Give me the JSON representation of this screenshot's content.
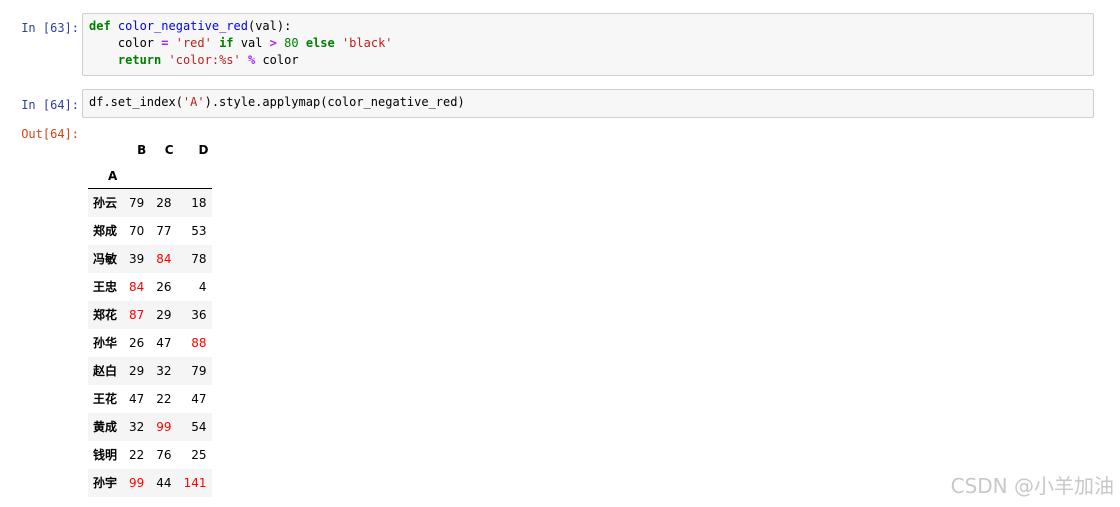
{
  "cells": [
    {
      "prompt": "In  [63]:",
      "code": {
        "l1_def": "def",
        "l1_name": "color_negative_red",
        "l1_rest": "(val):",
        "l2_a": "    color ",
        "l2_eq": "=",
        "l2_b": " ",
        "l2_red": "'red'",
        "l2_c": " ",
        "l2_if": "if",
        "l2_d": " val ",
        "l2_gt": ">",
        "l2_e": " ",
        "l2_num": "80",
        "l2_f": " ",
        "l2_else": "else",
        "l2_g": " ",
        "l2_black": "'black'",
        "l3_a": "    ",
        "l3_return": "return",
        "l3_b": " ",
        "l3_fmt": "'color:%s'",
        "l3_c": " ",
        "l3_mod": "%",
        "l3_d": " color"
      }
    },
    {
      "prompt": "In  [64]:",
      "code": {
        "a": "df.set_index(",
        "s": "'A'",
        "b": ").style.applymap(color_negative_red)"
      }
    }
  ],
  "output": {
    "prompt": "Out[64]:",
    "columns": [
      "B",
      "C",
      "D"
    ],
    "index_name": "A",
    "rows": [
      {
        "index": "孙云",
        "B": "79",
        "C": "28",
        "D": "18"
      },
      {
        "index": "郑成",
        "B": "70",
        "C": "77",
        "D": "53"
      },
      {
        "index": "冯敏",
        "B": "39",
        "C": "84",
        "D": "78"
      },
      {
        "index": "王忠",
        "B": "84",
        "C": "26",
        "D": "4"
      },
      {
        "index": "郑花",
        "B": "87",
        "C": "29",
        "D": "36"
      },
      {
        "index": "孙华",
        "B": "26",
        "C": "47",
        "D": "88"
      },
      {
        "index": "赵白",
        "B": "29",
        "C": "32",
        "D": "79"
      },
      {
        "index": "王花",
        "B": "47",
        "C": "22",
        "D": "47"
      },
      {
        "index": "黄成",
        "B": "32",
        "C": "99",
        "D": "54"
      },
      {
        "index": "钱明",
        "B": "22",
        "C": "76",
        "D": "25"
      },
      {
        "index": "孙宇",
        "B": "99",
        "C": "44",
        "D": "141"
      }
    ],
    "highlight_color": "#ff0000"
  },
  "watermark": "CSDN @小羊加油"
}
